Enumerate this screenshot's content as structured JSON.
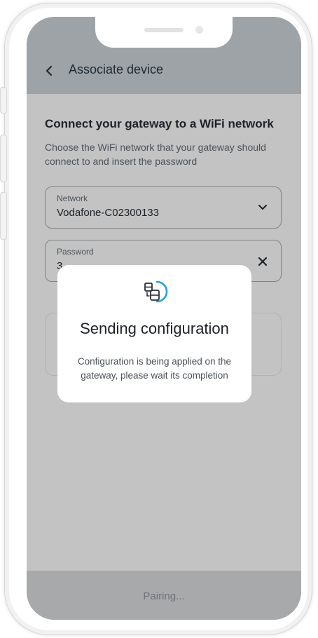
{
  "header": {
    "back_icon": "chevron-left-icon",
    "title": "Associate device"
  },
  "section": {
    "title": "Connect your gateway to a WiFi network",
    "description": "Choose the WiFi network that your gateway should connect to and insert the password"
  },
  "network_field": {
    "label": "Network",
    "value": "Vodafone-C02300133",
    "icon": "chevron-down-icon"
  },
  "password_field": {
    "label": "Password",
    "value": "3",
    "icon": "clear-icon"
  },
  "modal": {
    "icon": "device-sync-icon",
    "title": "Sending configuration",
    "body": "Configuration is being applied on the gateway, please wait its completion"
  },
  "bottom_bar": {
    "label": "Pairing..."
  },
  "colors": {
    "overlay": "#c3c3c3",
    "header": "#9ea3a8",
    "accent": "#2a9fd6",
    "text_primary": "#1c2228"
  }
}
